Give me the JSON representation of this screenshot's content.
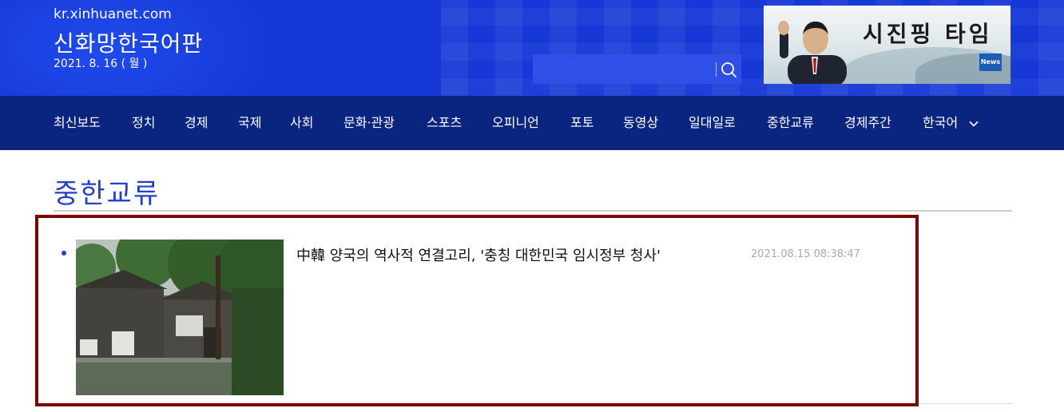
{
  "header": {
    "domain": "kr.xinhuanet.com",
    "site_title": "신화망한국어판",
    "date": "2021. 8. 16 ( 월 )",
    "search": {
      "placeholder": "",
      "value": "",
      "icon": "search-icon"
    },
    "banner": {
      "text": "시진핑 타임",
      "logo_text": "新华网 News"
    },
    "colors": {
      "header_bg": "#1638d6",
      "nav_bg": "#0a2580"
    }
  },
  "nav": {
    "items": [
      "최신보도",
      "정치",
      "경제",
      "국제",
      "사회",
      "문화·관광",
      "스포츠",
      "오피니언",
      "포토",
      "동영상",
      "일대일로",
      "중한교류",
      "경제주간",
      "한국어"
    ],
    "language_icon": "chevron-down-icon"
  },
  "section": {
    "title": "중한교류",
    "title_color": "#2440c8"
  },
  "articles": [
    {
      "headline": "中韓 양국의 역사적 연결고리, '충칭 대한민국 임시정부 청사'",
      "timestamp": "2021.08.15 08:38:47"
    }
  ],
  "highlight": {
    "color": "#7a0000"
  }
}
